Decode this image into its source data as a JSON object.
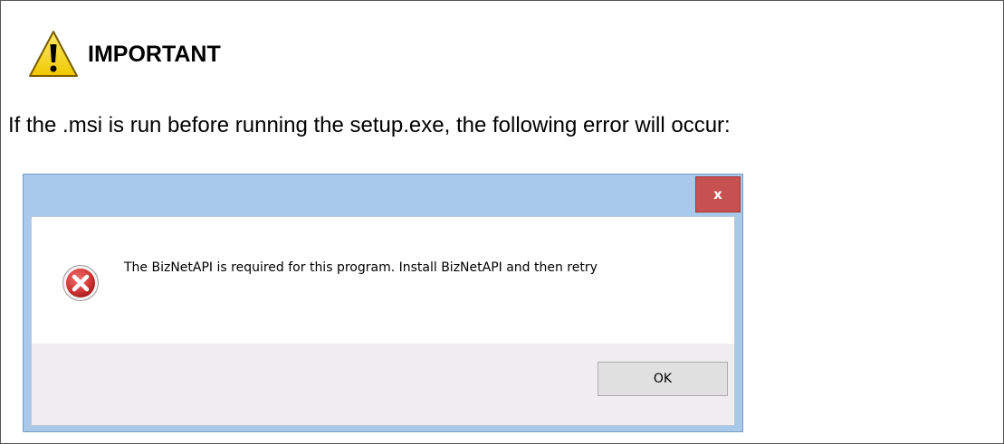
{
  "note": {
    "title": "IMPORTANT",
    "icon": "warning-triangle-icon",
    "intro": "If the .msi is run before running the setup.exe, the following error will occur:"
  },
  "dialog": {
    "close_label": "x",
    "message": "The BizNetAPI is required for this program.  Install BizNetAPI and then retry",
    "icon": "error-icon",
    "ok_label": "OK"
  },
  "colors": {
    "warning_fill": "#f5d20f",
    "titlebar": "#a9c9ea",
    "close_button": "#c75050",
    "error_icon": "#d63a3a"
  }
}
